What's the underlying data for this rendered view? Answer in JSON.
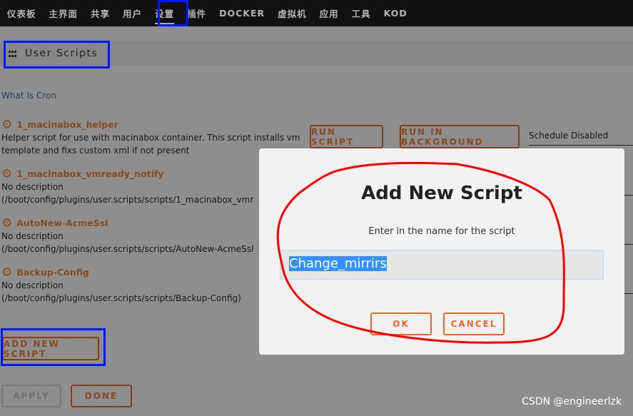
{
  "nav": {
    "items": [
      "仪表板",
      "主界面",
      "共享",
      "用户",
      "设置",
      "插件",
      "DOCKER",
      "虚拟机",
      "应用",
      "工具",
      "KOD"
    ],
    "active": "设置"
  },
  "header": {
    "title": "User Scripts",
    "icon": "grid-icon"
  },
  "cron_link": "What Is Cron",
  "scripts": [
    {
      "name": "1_macinabox_helper",
      "desc": "Helper script for use with macinabox container. This script installs vm template and fixs custom xml if not present"
    },
    {
      "name": "1_macinabox_vmready_notify",
      "desc": "No description",
      "path": "(/boot/config/plugins/user.scripts/scripts/1_macinabox_vmr"
    },
    {
      "name": "AutoNew-AcmeSsl",
      "desc": "No description",
      "path": "(/boot/config/plugins/user.scripts/scripts/AutoNew-AcmeSsl"
    },
    {
      "name": "Backup-Config",
      "desc": "No description",
      "path": "(/boot/config/plugins/user.scripts/scripts/Backup-Config)"
    }
  ],
  "row_actions": {
    "run": "RUN SCRIPT",
    "run_bg": "RUN IN BACKGROUND",
    "schedule": "Schedule Disabled"
  },
  "add_new": "ADD NEW SCRIPT",
  "apply": "APPLY",
  "done": "DONE",
  "modal": {
    "title": "Add New Script",
    "prompt": "Enter in the name for the script",
    "value": "Change_mirrirs",
    "ok": "OK",
    "cancel": "CANCEL"
  },
  "watermark": "CSDN @engineerlzk",
  "colors": {
    "accent": "#f26522",
    "annotation_box": "#0018ff",
    "annotation_circle": "#ff0000",
    "selection": "#3391ff"
  }
}
